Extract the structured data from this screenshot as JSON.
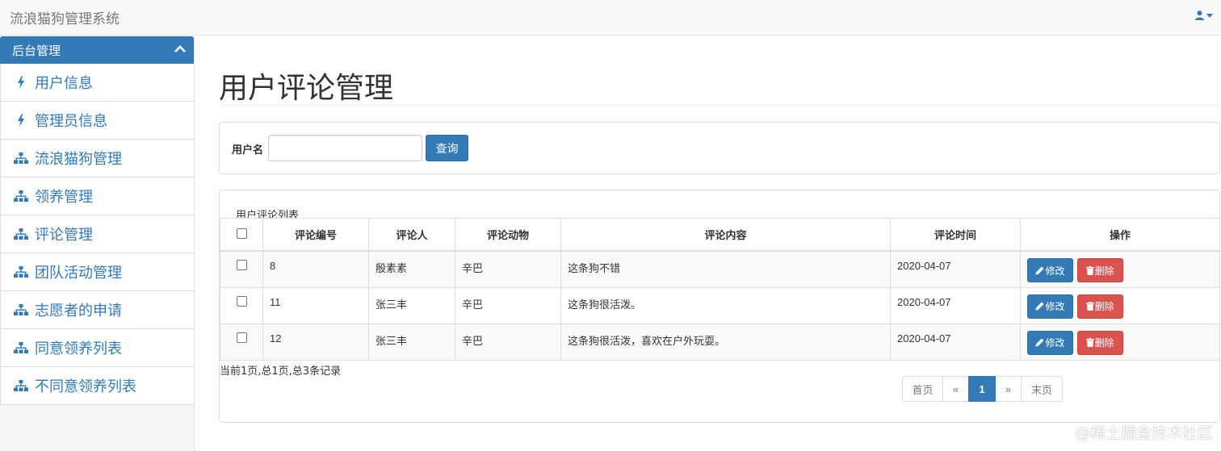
{
  "app": {
    "title": "流浪猫狗管理系统"
  },
  "sidebar": {
    "header": "后台管理",
    "items": [
      {
        "label": "用户信息",
        "icon": "bolt-icon"
      },
      {
        "label": "管理员信息",
        "icon": "bolt-icon"
      },
      {
        "label": "流浪猫狗管理",
        "icon": "sitemap-icon"
      },
      {
        "label": "领养管理",
        "icon": "sitemap-icon"
      },
      {
        "label": "评论管理",
        "icon": "sitemap-icon"
      },
      {
        "label": "团队活动管理",
        "icon": "sitemap-icon"
      },
      {
        "label": "志愿者的申请",
        "icon": "sitemap-icon"
      },
      {
        "label": "同意领养列表",
        "icon": "sitemap-icon"
      },
      {
        "label": "不同意领养列表",
        "icon": "sitemap-icon"
      }
    ]
  },
  "main": {
    "title": "用户评论管理",
    "search": {
      "label": "用户名",
      "value": "",
      "placeholder": "",
      "button": "查询"
    },
    "list": {
      "title": "用户评论列表",
      "columns": [
        "评论编号",
        "评论人",
        "评论动物",
        "评论内容",
        "评论时间",
        "操作"
      ],
      "rows": [
        {
          "id": "8",
          "user": "殷素素",
          "animal": "辛巴",
          "content": "这条狗不错",
          "time": "2020-04-07"
        },
        {
          "id": "11",
          "user": "张三丰",
          "animal": "辛巴",
          "content": "这条狗很活泼。",
          "time": "2020-04-07"
        },
        {
          "id": "12",
          "user": "张三丰",
          "animal": "辛巴",
          "content": "这条狗很活泼，喜欢在户外玩耍。",
          "time": "2020-04-07"
        }
      ],
      "edit_label": "修改",
      "delete_label": "删除",
      "summary": "当前1页,总1页,总3条记录",
      "pagination": {
        "first": "首页",
        "prev": "«",
        "current": "1",
        "next": "»",
        "last": "末页"
      }
    }
  },
  "watermark": "@稀土掘金技术社区",
  "colors": {
    "primary": "#337ab7",
    "danger": "#d9534f",
    "link": "#337ab7"
  }
}
